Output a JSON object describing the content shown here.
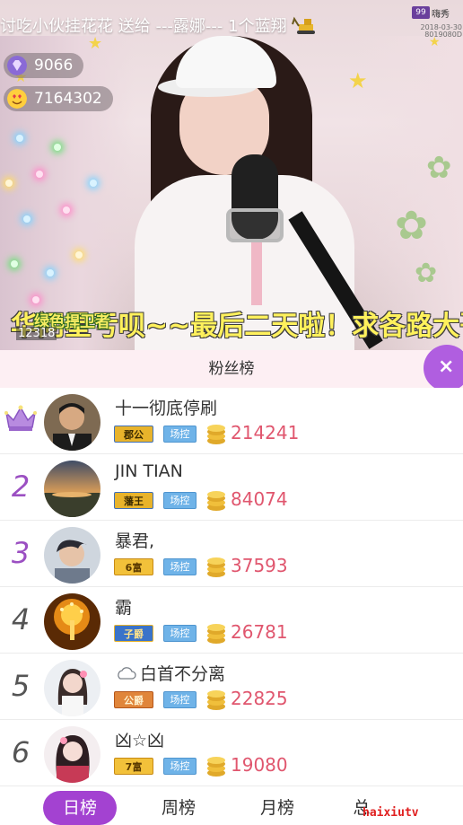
{
  "stream": {
    "top_message": "讨吃小伙挂花花 送给 ---露娜--- 1个蓝翔",
    "platform": {
      "name": "嗨秀",
      "date": "2018-03-30",
      "id": "8019080D"
    },
    "stats": [
      {
        "icon": "gem-icon",
        "value": "9066"
      },
      {
        "icon": "heart-eyes-icon",
        "value": "7164302"
      }
    ],
    "guard_badge": {
      "label": "绿色捍卫者",
      "number": "12318"
    },
    "marquee": "华问星亏呗~~最后二天啦！求各路大哥"
  },
  "panel": {
    "title": "粉丝榜",
    "close_label": "×",
    "fans": [
      {
        "rank": "",
        "rank_icon": "crown-icon",
        "name": "十一彻底停刷",
        "title_badge": "郡公",
        "title_color": "#d9a11f",
        "role": "场控",
        "score": "214241"
      },
      {
        "rank": "2",
        "name": "JIN TIAN",
        "title_badge": "藩王",
        "title_color": "#d9a11f",
        "role": "场控",
        "score": "84074"
      },
      {
        "rank": "3",
        "name": "暴君,",
        "title_badge": "6富",
        "title_color": "#efb52e",
        "role": "场控",
        "score": "37593"
      },
      {
        "rank": "4",
        "name": "霸",
        "title_badge": "子爵",
        "title_color": "#3a73c9",
        "role": "场控",
        "score": "26781"
      },
      {
        "rank": "5",
        "name": "白首不分离",
        "name_icon": "cloud-icon",
        "title_badge": "公爵",
        "title_color": "#e0853a",
        "role": "场控",
        "score": "22825"
      },
      {
        "rank": "6",
        "name": "凶☆凶",
        "title_badge": "7富",
        "title_color": "#efb52e",
        "role": "场控",
        "score": "19080"
      }
    ]
  },
  "tabs": [
    {
      "label": "日榜",
      "active": true
    },
    {
      "label": "周榜",
      "active": false
    },
    {
      "label": "月榜",
      "active": false
    },
    {
      "label": "总",
      "active": false
    }
  ],
  "watermark": "haixiutv"
}
